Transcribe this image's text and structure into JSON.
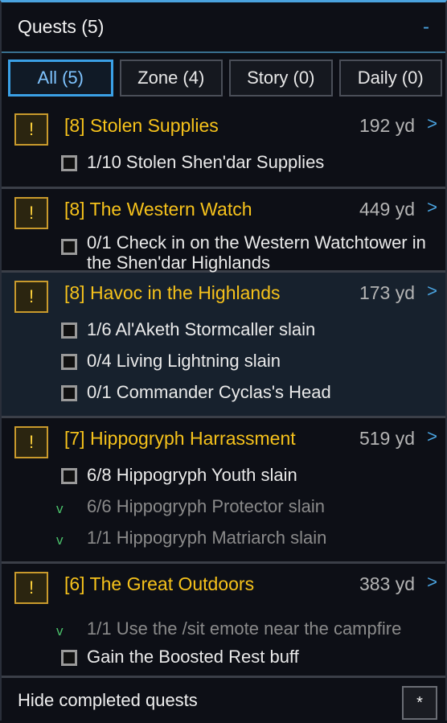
{
  "header": {
    "title": "Quests (5)",
    "collapse": "-"
  },
  "tabs": [
    {
      "label": "All (5)",
      "active": true
    },
    {
      "label": "Zone (4)",
      "active": false
    },
    {
      "label": "Story (0)",
      "active": false
    },
    {
      "label": "Daily (0)",
      "active": false
    }
  ],
  "quests": [
    {
      "mark": "!",
      "title": "[8] Stolen Supplies",
      "distance": "192 yd",
      "arrow": ">",
      "highlight": false,
      "objectives": [
        {
          "text": "1/10 Stolen Shen'dar Supplies",
          "done": false
        }
      ]
    },
    {
      "mark": "!",
      "title": "[8] The Western Watch",
      "distance": "449 yd",
      "arrow": ">",
      "highlight": false,
      "objectives": [
        {
          "text": "0/1 Check in on the Western Watchtower in the Shen'dar Highlands",
          "done": false
        }
      ]
    },
    {
      "mark": "!",
      "title": "[8] Havoc in the Highlands",
      "distance": "173 yd",
      "arrow": ">",
      "highlight": true,
      "objectives": [
        {
          "text": "1/6 Al'Aketh Stormcaller slain",
          "done": false
        },
        {
          "text": "0/4 Living Lightning slain",
          "done": false
        },
        {
          "text": "0/1 Commander Cyclas's Head",
          "done": false
        }
      ]
    },
    {
      "mark": "!",
      "title": "[7] Hippogryph Harrassment",
      "distance": "519 yd",
      "arrow": ">",
      "highlight": false,
      "objectives": [
        {
          "text": "6/8 Hippogryph Youth slain",
          "done": false
        },
        {
          "text": "6/6 Hippogryph Protector slain",
          "done": true
        },
        {
          "text": "1/1 Hippogryph Matriarch slain",
          "done": true
        }
      ]
    },
    {
      "mark": "!",
      "title": "[6] The Great Outdoors",
      "distance": "383 yd",
      "arrow": ">",
      "highlight": false,
      "objectives": [
        {
          "text": "1/1 Use the /sit emote near the campfire",
          "done": true
        },
        {
          "text": "Gain the Boosted Rest buff",
          "done": false
        }
      ]
    }
  ],
  "done_mark": "v",
  "footer": {
    "label": "Hide completed quests",
    "button": "*"
  }
}
